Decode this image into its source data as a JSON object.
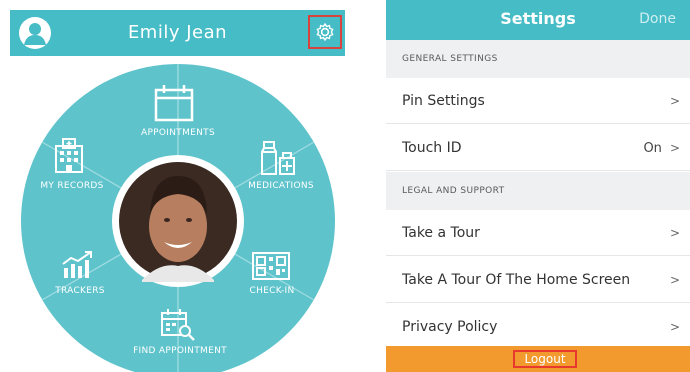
{
  "home": {
    "user_name": "Emily Jean",
    "segments": {
      "appointments": "APPOINTMENTS",
      "medications": "MEDICATIONS",
      "check_in": "CHECK-IN",
      "find_appointment": "FIND APPOINTMENT",
      "trackers": "TRACKERS",
      "my_records": "MY RECORDS"
    }
  },
  "settings": {
    "title": "Settings",
    "done": "Done",
    "general_header": "GENERAL SETTINGS",
    "pin_settings": "Pin Settings",
    "touch_id": "Touch ID",
    "touch_id_value": "On",
    "legal_header": "LEGAL AND SUPPORT",
    "take_tour": "Take a Tour",
    "take_tour_home": "Take A Tour Of The Home Screen",
    "privacy_policy": "Privacy Policy",
    "logout": "Logout"
  },
  "colors": {
    "teal": "#45bcc6",
    "orange": "#f39a2e",
    "highlight": "#d8433b"
  },
  "icons": [
    "user-avatar-icon",
    "gear-icon",
    "calendar-icon",
    "medicine-bottles-icon",
    "qr-code-icon",
    "calendar-search-icon",
    "trend-chart-icon",
    "hospital-icon",
    "chevron-right-icon"
  ]
}
